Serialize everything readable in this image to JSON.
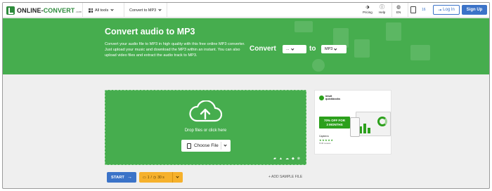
{
  "nav": {
    "logo_text_left": "ONLINE-",
    "logo_text_right": "CONVERT",
    "logo_suffix": ".com",
    "all_tools": "All tools",
    "current_tool": "Convert to MP3",
    "pricing": "Pricing",
    "help": "Help",
    "language": "EN",
    "history_count": "16",
    "login": "Log In",
    "signup": "Sign Up"
  },
  "hero": {
    "title": "Convert audio to MP3",
    "description": "Convert your audio file to MP3 in high quality with this free online MP3 converter. Just upload your music and download the MP3 within an instant. You can also upload video files and extract the audio track to MP3.",
    "convert_label": "Convert",
    "from_value": "...",
    "to_label": "to",
    "to_value": "MP3"
  },
  "upload": {
    "drop_text": "Drop files or click here",
    "choose_file": "Choose File"
  },
  "ad": {
    "brand_line1": "intuit",
    "brand_line2": "quickbooks",
    "promo_line1": "70% OFF FOR",
    "promo_line2": "3 MONTHS",
    "rating_label": "Capterra",
    "stars": "★★★★★",
    "reviews": "5745 reviews"
  },
  "actions": {
    "start": "START",
    "file_count": "1",
    "timer": "30 s",
    "add_sample": "+ ADD SAMPLE FILE"
  },
  "colors": {
    "hero_green": "#46ad4e",
    "primary_blue": "#3b73c8",
    "options_orange": "#f6b12c",
    "quickbooks_green": "#2ca01c"
  }
}
